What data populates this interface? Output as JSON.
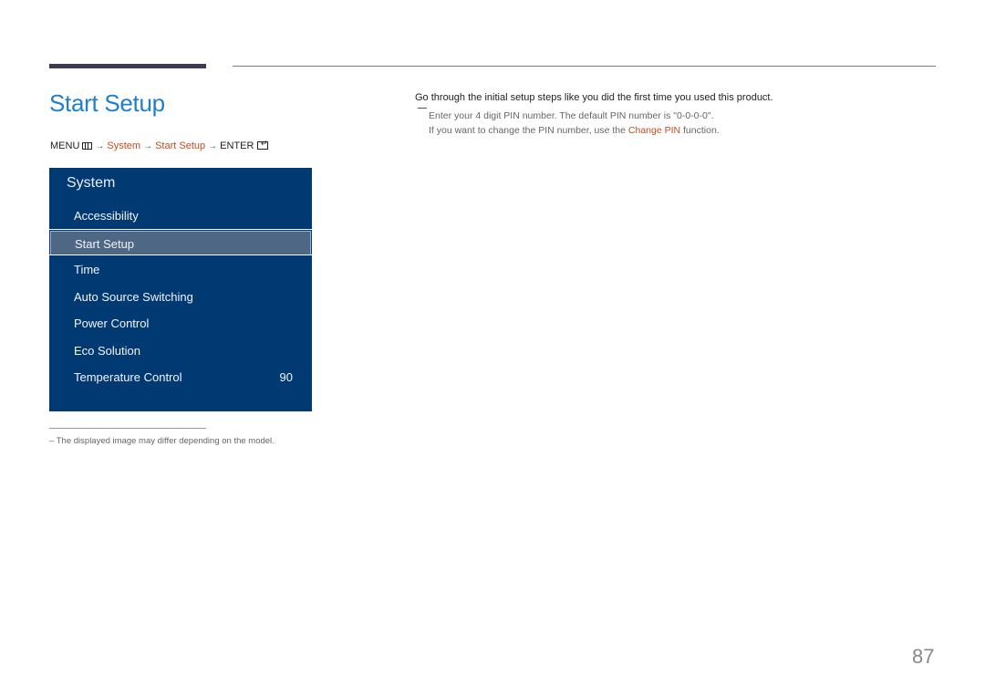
{
  "page": {
    "title": "Start Setup",
    "page_number": "87"
  },
  "breadcrumb": {
    "menu": "MENU",
    "system": "System",
    "start_setup": "Start Setup",
    "enter": "ENTER",
    "arrow": "→"
  },
  "osd": {
    "title": "System",
    "items": [
      {
        "label": "Accessibility",
        "value": ""
      },
      {
        "label": "Start Setup",
        "value": "",
        "selected": true
      },
      {
        "label": "Time",
        "value": ""
      },
      {
        "label": "Auto Source Switching",
        "value": ""
      },
      {
        "label": "Power Control",
        "value": ""
      },
      {
        "label": "Eco Solution",
        "value": ""
      },
      {
        "label": "Temperature Control",
        "value": "90"
      }
    ],
    "colors": {
      "background": "#013a72",
      "selected": "#4e6784"
    }
  },
  "description": {
    "main": "Go through the initial setup steps like you did the first time you used this product.",
    "note_line1": "Enter your 4 digit PIN number. The default PIN number is \"0-0-0-0\".",
    "note_line2_pre": "If you want to change the PIN number, use the ",
    "note_line2_link": "Change PIN",
    "note_line2_post": " function."
  },
  "footnote": "–  The displayed image may differ depending on the model.",
  "colors": {
    "title": "#1f80c8",
    "highlight": "#c84a1e"
  }
}
